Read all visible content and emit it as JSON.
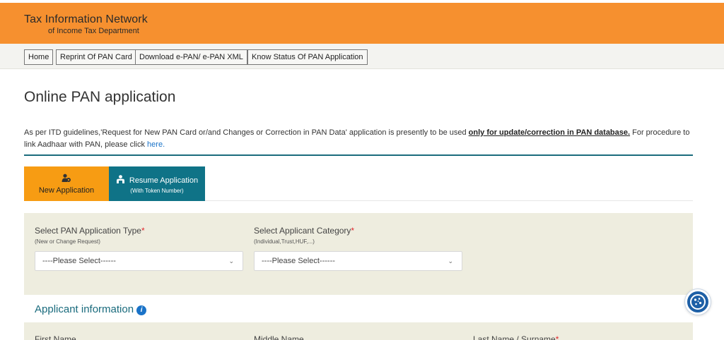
{
  "header": {
    "title": "Tax Information Network",
    "subtitle": "of Income Tax Department"
  },
  "nav": {
    "items": [
      "Home",
      "Reprint Of PAN Card",
      "Download e-PAN/ e-PAN XML",
      "Know Status Of PAN Application"
    ]
  },
  "page": {
    "title": "Online PAN application",
    "notice_prefix": "As per ITD guidelines,'Request for New PAN Card or/and Changes or Correction in PAN Data' application is presently to be used ",
    "notice_strong": "only for update/correction in PAN database.",
    "notice_middle": " For procedure to link Aadhaar with PAN, please click ",
    "notice_link": "here."
  },
  "tabs": {
    "new_label": "New Application",
    "resume_label": "Resume Application",
    "resume_sub": "(With Token Number)",
    "new_color": "#f79c13",
    "resume_color": "#0f7387"
  },
  "form": {
    "app_type_label": "Select PAN Application Type",
    "app_type_sub": "(New or Change Request)",
    "app_type_value": "----Please Select------",
    "category_label": "Select Applicant Category",
    "category_sub": "(Individual,Trust,HUF,...)",
    "category_value": "----Please Select------",
    "required_mark": "*"
  },
  "applicant": {
    "section_title": "Applicant information",
    "info_glyph": "i",
    "first_name": "First Name",
    "middle_name": "Middle Name",
    "last_name": "Last Name / Surname"
  },
  "icons": {
    "chevron": "⌄",
    "new_app": "new-application-icon",
    "resume": "resume-application-icon",
    "cookie": "cookie-icon"
  },
  "colors": {
    "header": "#f6902f",
    "accent": "#1a6b7d",
    "panel": "#eeeddf",
    "link": "#1a73c8",
    "required": "#e0262b"
  }
}
